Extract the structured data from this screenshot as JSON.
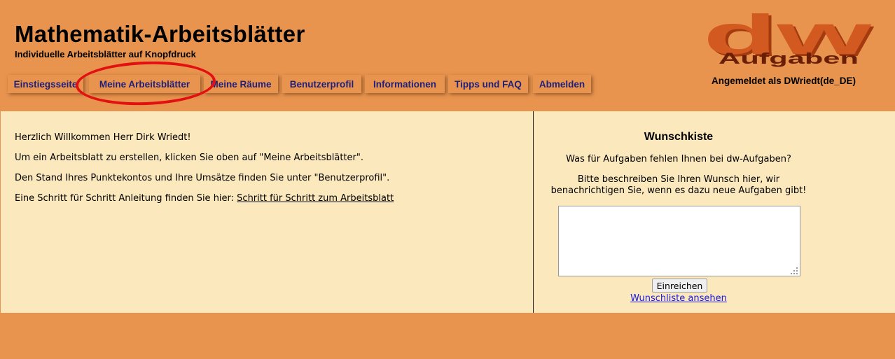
{
  "header": {
    "title": "Mathematik-Arbeitsblätter",
    "subtitle": "Individuelle Arbeitsblätter auf Knopfdruck",
    "logo_text_large": "dw",
    "logo_text_small": "Aufgaben",
    "logged_in": "Angemeldet als DWriedt(de_DE)"
  },
  "nav": {
    "items": [
      {
        "label": "Einstiegsseite"
      },
      {
        "label": "Meine Arbeitsblätter"
      },
      {
        "label": "Meine Räume"
      },
      {
        "label": "Benutzerprofil"
      },
      {
        "label": "Informationen"
      },
      {
        "label": "Tipps und FAQ"
      },
      {
        "label": "Abmelden"
      }
    ]
  },
  "main": {
    "greeting": "Herzlich Willkommen Herr Dirk Wriedt!",
    "line1": "Um ein Arbeitsblatt zu erstellen, klicken Sie oben auf \"Meine Arbeitsblätter\".",
    "line2": "Den Stand Ihres Punktekontos und Ihre Umsätze finden Sie unter \"Benutzerprofil\".",
    "line3_prefix": "Eine Schritt für Schritt Anleitung finden Sie hier: ",
    "line3_link": "Schritt für Schritt zum Arbeitsblatt"
  },
  "wishbox": {
    "title": "Wunschkiste",
    "question": "Was für Aufgaben fehlen Ihnen bei dw-Aufgaben?",
    "instruction_line1": "Bitte beschreiben Sie Ihren Wunsch hier, wir",
    "instruction_line2": "benachrichtigen Sie, wenn es dazu neue Aufgaben gibt!",
    "textarea_value": "",
    "submit_label": "Einreichen",
    "list_link": "Wunschliste ansehen"
  },
  "colors": {
    "background": "#e8944f",
    "content_background": "#fbe8bd",
    "nav_text": "#20207a",
    "annotation": "#e21010",
    "logo": "#c9521c",
    "link": "#1a1ae6"
  }
}
